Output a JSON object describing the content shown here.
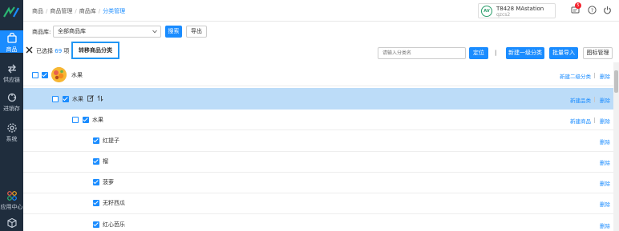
{
  "sidebar": {
    "items": [
      {
        "label": "商品",
        "icon": "bag-icon",
        "active": true
      },
      {
        "label": "供应链",
        "icon": "supply-chain-icon"
      },
      {
        "label": "进销存",
        "icon": "inventory-icon"
      },
      {
        "label": "系统",
        "icon": "gear-icon"
      },
      {
        "label": "应用中心",
        "icon": "app-center-icon"
      },
      {
        "label": "",
        "icon": "cube-icon"
      }
    ]
  },
  "header": {
    "breadcrumb": [
      "商品",
      "商品管理",
      "商品库",
      "分类管理"
    ],
    "user": {
      "avatar_text": "AV",
      "name": "T8428 MAstation",
      "sub": "qzcs2"
    },
    "notification_count": "5"
  },
  "filter": {
    "label": "商品库:",
    "select_value": "全部商品库",
    "search_label": "搜索",
    "export_label": "导出"
  },
  "toolbar": {
    "selected_prefix": "已选择",
    "selected_count": "69",
    "selected_suffix": "项",
    "move_label": "转移商品分类",
    "category_placeholder": "请输入分类名",
    "locate_label": "定位",
    "separator": "|",
    "new_primary_label": "新建一级分类",
    "batch_import_label": "批量导入",
    "icon_manage_label": "图标管理"
  },
  "tree": {
    "level1": {
      "label": "水果",
      "action1": "新建二级分类",
      "action2": "删除"
    },
    "level2": {
      "label": "水果",
      "action1": "新建品类",
      "action2": "删除"
    },
    "level3": {
      "label": "水果",
      "action1": "新建商品",
      "action2": "删除"
    },
    "products": [
      {
        "label": "红提子",
        "action": "删除"
      },
      {
        "label": "榴",
        "action": "删除"
      },
      {
        "label": "菠萝",
        "action": "删除"
      },
      {
        "label": "无籽西瓜",
        "action": "删除"
      },
      {
        "label": "红心芭乐",
        "action": "删除"
      }
    ]
  },
  "colors": {
    "accent": "#1a8cff",
    "sidebar_bg": "#1f2d3d",
    "highlight_row": "#bcdcf8",
    "focus_border": "#2196f3"
  }
}
